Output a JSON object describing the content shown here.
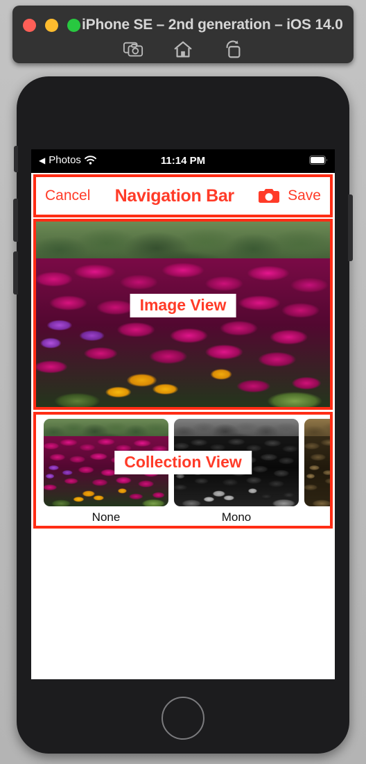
{
  "simulator": {
    "title": "iPhone SE – 2nd generation – iOS 14.0",
    "window_controls": [
      {
        "name": "close",
        "color": "#ff5f57"
      },
      {
        "name": "minimize",
        "color": "#febc2e"
      },
      {
        "name": "zoom",
        "color": "#28c840"
      }
    ],
    "toolbar_icons": [
      "screenshot-icon",
      "home-icon",
      "rotate-icon"
    ]
  },
  "status_bar": {
    "back_arrow": "◀",
    "back_label": "Photos",
    "wifi": "wifi-icon",
    "time": "11:14 PM",
    "battery": "battery-icon"
  },
  "annotations": {
    "accent_color": "#ff2d15",
    "text_color": "#ff3b28",
    "navigation_bar_label": "Navigation Bar",
    "image_view_label": "Image View",
    "collection_view_label": "Collection View"
  },
  "navigation_bar": {
    "cancel_label": "Cancel",
    "title": "Navigation Bar",
    "camera_icon": "camera-icon",
    "save_label": "Save"
  },
  "image_view": {
    "alt": "Field of magenta ice plant flowers with yellow blooms",
    "overlay_label": "Image View"
  },
  "collection_view": {
    "overlay_label": "Collection View",
    "cells": [
      {
        "label": "None",
        "filter": "none"
      },
      {
        "label": "Mono",
        "filter": "mono"
      },
      {
        "label": "",
        "filter": "sepia"
      }
    ]
  }
}
